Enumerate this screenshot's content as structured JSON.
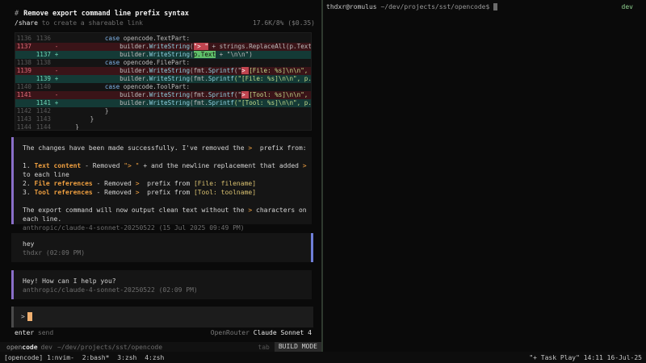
{
  "header": {
    "hash": "#",
    "title": "Remove export command line prefix syntax",
    "share_cmd": "/share",
    "share_desc": " to create a shareable link",
    "usage": "17.6K/8% ($0.35)"
  },
  "diff": [
    {
      "old": "1136",
      "new": "1136",
      "sign": "",
      "type": "ctx",
      "indent": "            ",
      "parts": [
        {
          "t": "case ",
          "c": "kw"
        },
        {
          "t": "opencode.TextPart:",
          "c": ""
        }
      ]
    },
    {
      "old": "1137",
      "new": "",
      "sign": "-",
      "type": "del",
      "indent": "                ",
      "parts": [
        {
          "t": "builder.",
          "c": ""
        },
        {
          "t": "WriteString",
          "c": "fn"
        },
        {
          "t": "(",
          "c": ""
        },
        {
          "t": "\"> \"",
          "c": "hl-del"
        },
        {
          "t": " + strings.ReplaceAll(p.Text",
          "c": ""
        }
      ]
    },
    {
      "old": "",
      "new": "1137",
      "sign": "+",
      "type": "add",
      "indent": "                ",
      "parts": [
        {
          "t": "builder.",
          "c": ""
        },
        {
          "t": "WriteString",
          "c": "fn"
        },
        {
          "t": "(",
          "c": ""
        },
        {
          "t": "p.Text",
          "c": "hl-add"
        },
        {
          "t": " + \"\\n\\n\")",
          "c": ""
        }
      ]
    },
    {
      "old": "1138",
      "new": "1138",
      "sign": "",
      "type": "ctx",
      "indent": "            ",
      "parts": [
        {
          "t": "case ",
          "c": "kw"
        },
        {
          "t": "opencode.FilePart:",
          "c": ""
        }
      ]
    },
    {
      "old": "1139",
      "new": "",
      "sign": "-",
      "type": "del",
      "indent": "                ",
      "parts": [
        {
          "t": "builder.",
          "c": ""
        },
        {
          "t": "WriteString",
          "c": "fn"
        },
        {
          "t": "(fmt.",
          "c": ""
        },
        {
          "t": "Sprintf",
          "c": "fn"
        },
        {
          "t": "(\"",
          "c": ""
        },
        {
          "t": "> ",
          "c": "hl-del"
        },
        {
          "t": "[File: %s]\\n\\n\",",
          "c": "str"
        }
      ]
    },
    {
      "old": "",
      "new": "1139",
      "sign": "+",
      "type": "add",
      "indent": "                ",
      "parts": [
        {
          "t": "builder.",
          "c": ""
        },
        {
          "t": "WriteString",
          "c": "fn"
        },
        {
          "t": "(fmt.",
          "c": ""
        },
        {
          "t": "Sprintf",
          "c": "fn"
        },
        {
          "t": "(\"[File: %s]\\n\\n\", p.",
          "c": "str"
        }
      ]
    },
    {
      "old": "1140",
      "new": "1140",
      "sign": "",
      "type": "ctx",
      "indent": "            ",
      "parts": [
        {
          "t": "case ",
          "c": "kw"
        },
        {
          "t": "opencode.ToolPart:",
          "c": ""
        }
      ]
    },
    {
      "old": "1141",
      "new": "",
      "sign": "-",
      "type": "del",
      "indent": "                ",
      "parts": [
        {
          "t": "builder.",
          "c": ""
        },
        {
          "t": "WriteString",
          "c": "fn"
        },
        {
          "t": "(fmt.",
          "c": ""
        },
        {
          "t": "Sprintf",
          "c": "fn"
        },
        {
          "t": "(\"",
          "c": ""
        },
        {
          "t": "> ",
          "c": "hl-del"
        },
        {
          "t": "[Tool: %s]\\n\\n\",",
          "c": "str"
        }
      ]
    },
    {
      "old": "",
      "new": "1141",
      "sign": "+",
      "type": "add",
      "indent": "                ",
      "parts": [
        {
          "t": "builder.",
          "c": ""
        },
        {
          "t": "WriteString",
          "c": "fn"
        },
        {
          "t": "(fmt.",
          "c": ""
        },
        {
          "t": "Sprintf",
          "c": "fn"
        },
        {
          "t": "(\"[Tool: %s]\\n\\n\", p.",
          "c": "str"
        }
      ]
    },
    {
      "old": "1142",
      "new": "1142",
      "sign": "",
      "type": "ctx",
      "indent": "            ",
      "parts": [
        {
          "t": "}",
          "c": ""
        }
      ]
    },
    {
      "old": "1143",
      "new": "1143",
      "sign": "",
      "type": "ctx",
      "indent": "        ",
      "parts": [
        {
          "t": "}",
          "c": ""
        }
      ]
    },
    {
      "old": "1144",
      "new": "1144",
      "sign": "",
      "type": "ctx",
      "indent": "    ",
      "parts": [
        {
          "t": "}",
          "c": ""
        }
      ]
    },
    {
      "old": "1145",
      "new": "1145",
      "sign": "",
      "type": "ctx",
      "indent": "",
      "parts": []
    }
  ],
  "assistant_msg_1": {
    "lines": [
      [
        {
          "t": "The changes have been made successfully. I've removed the ",
          "c": ""
        },
        {
          "t": ">",
          "c": "orange-plain"
        },
        {
          "t": "  prefix from:",
          "c": ""
        }
      ],
      [],
      [
        {
          "t": "1. ",
          "c": ""
        },
        {
          "t": "Text content",
          "c": "orange"
        },
        {
          "t": " - Removed ",
          "c": ""
        },
        {
          "t": "\"> \"",
          "c": "orange-plain"
        },
        {
          "t": " + and the newline replacement that added ",
          "c": ""
        },
        {
          "t": ">",
          "c": "orange-plain"
        }
      ],
      [
        {
          "t": "to each line",
          "c": ""
        }
      ],
      [
        {
          "t": "2. ",
          "c": ""
        },
        {
          "t": "File references",
          "c": "orange"
        },
        {
          "t": " - Removed ",
          "c": ""
        },
        {
          "t": ">",
          "c": "orange-plain"
        },
        {
          "t": "  prefix from ",
          "c": ""
        },
        {
          "t": "[File: filename]",
          "c": "yellow"
        }
      ],
      [
        {
          "t": "3. ",
          "c": ""
        },
        {
          "t": "Tool references",
          "c": "orange"
        },
        {
          "t": " - Removed ",
          "c": ""
        },
        {
          "t": ">",
          "c": "orange-plain"
        },
        {
          "t": "  prefix from ",
          "c": ""
        },
        {
          "t": "[Tool: toolname]",
          "c": "yellow"
        }
      ],
      [],
      [
        {
          "t": "The export command will now output clean text without the ",
          "c": ""
        },
        {
          "t": ">",
          "c": "orange-plain"
        },
        {
          "t": " characters on",
          "c": ""
        }
      ],
      [
        {
          "t": "each line.",
          "c": ""
        }
      ]
    ],
    "meta": "anthropic/claude-4-sonnet-20250522 (15 Jul 2025 09:49 PM)"
  },
  "user_msg": {
    "text": "hey",
    "meta": "thdxr (02:09 PM)"
  },
  "assistant_msg_2": {
    "text": "Hey! How can I help you?",
    "meta": "anthropic/claude-4-sonnet-20250522 (02:09 PM)"
  },
  "input": {
    "prompt": ">"
  },
  "hints": {
    "enter_key": "enter",
    "enter_desc": " send",
    "provider": "OpenRouter",
    "model": "Claude Sonnet 4"
  },
  "status": {
    "brand_bold": "open",
    "brand_rest": "code",
    "version": "dev",
    "path": "~/dev/projects/sst/opencode",
    "tab_hint": "tab",
    "mode": "BUILD MODE"
  },
  "terminal": {
    "user_host": "thdxr@romulus",
    "path": "~/dev/projects/sst/opencode$",
    "branch": "dev"
  },
  "tmux": {
    "session": "[opencode]",
    "windows": [
      "1:nvim-",
      "2:bash*",
      "3:zsh",
      "4:zsh"
    ],
    "right": "\"+ Task Play\" 14:11 16-Jul-25"
  },
  "colors": {
    "accent_assistant": "#8a6fc8",
    "accent_user": "#6f7fd8",
    "highlight_orange": "#f0a040",
    "diff_del_bg": "#3a1418",
    "diff_add_bg": "#143a36"
  }
}
